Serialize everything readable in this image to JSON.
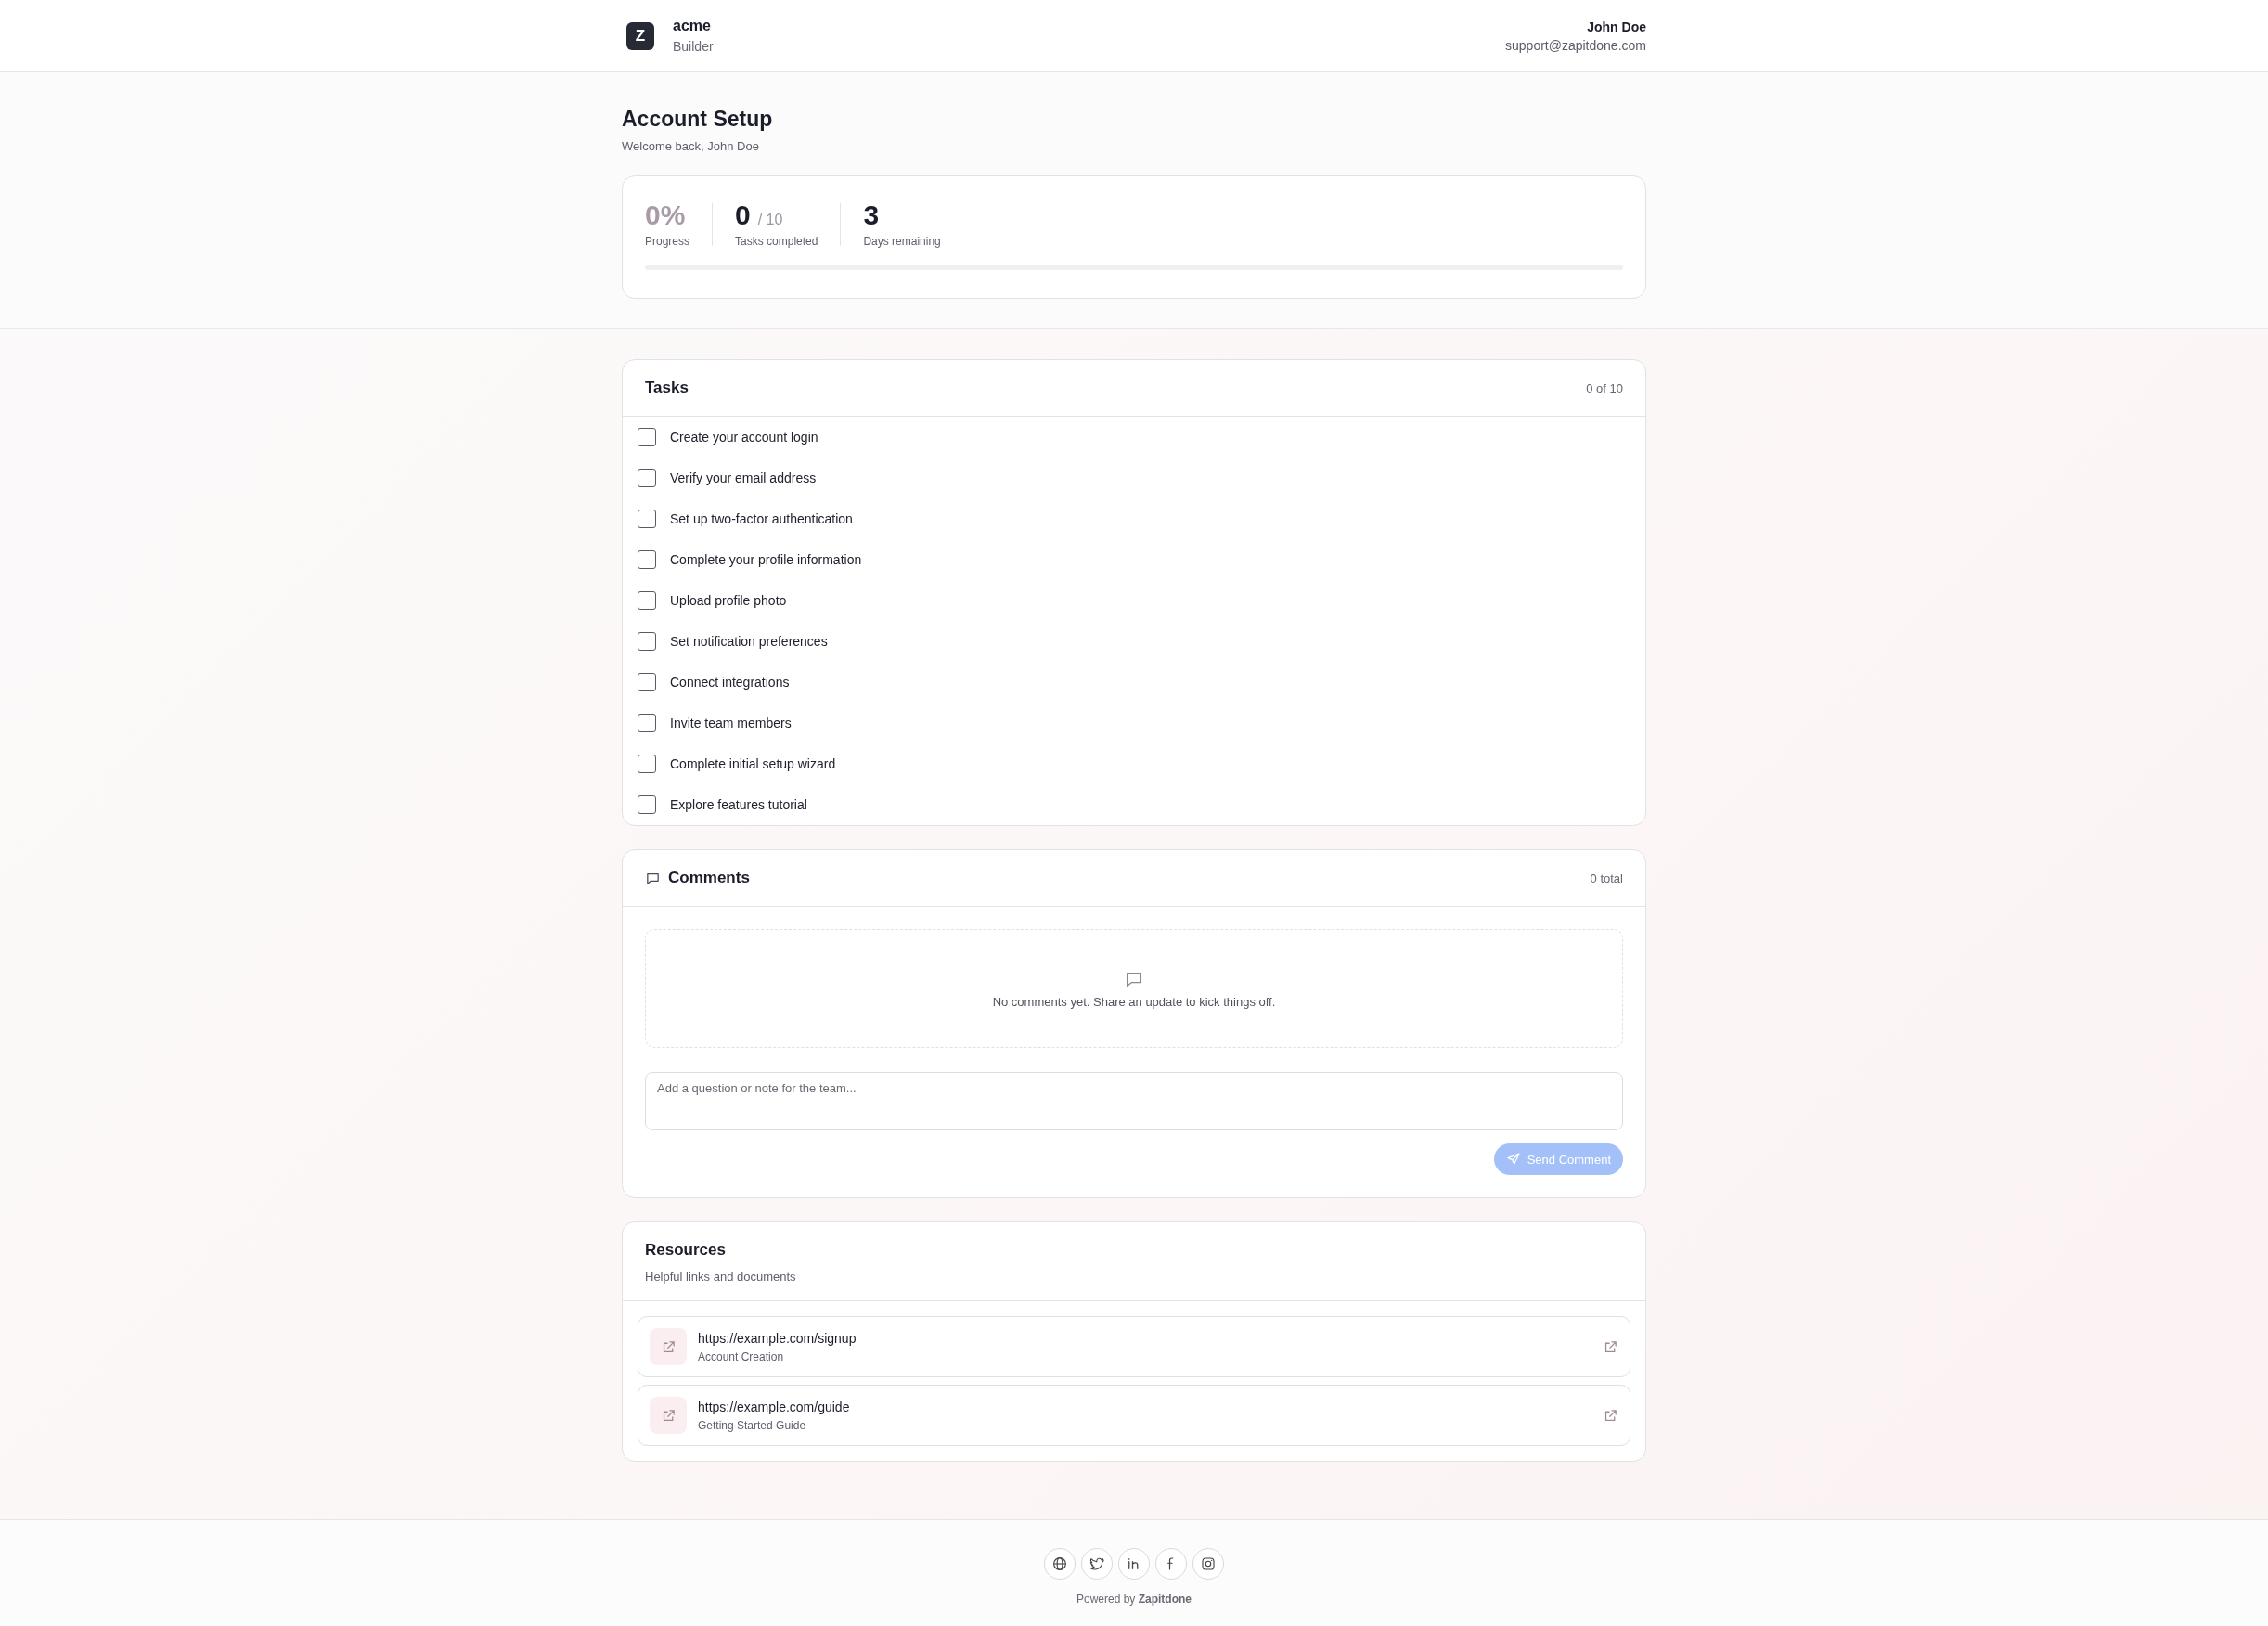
{
  "header": {
    "logo": "Z",
    "brand_name": "acme",
    "brand_subtitle": "Builder",
    "user_name": "John Doe",
    "user_email": "support@zapitdone.com"
  },
  "page": {
    "title": "Account Setup",
    "subtitle": "Welcome back, John Doe"
  },
  "stats": {
    "progress": {
      "value": "0%",
      "label": "Progress",
      "level": 0
    },
    "tasks": {
      "value": "0",
      "total": "/ 10",
      "label": "Tasks completed"
    },
    "days": {
      "value": "3",
      "label": "Days remaining"
    }
  },
  "tasks": {
    "title": "Tasks",
    "count": "0 of 10",
    "items": [
      {
        "label": "Create your account login",
        "checked": false
      },
      {
        "label": "Verify your email address",
        "checked": false
      },
      {
        "label": "Set up two-factor authentication",
        "checked": false
      },
      {
        "label": "Complete your profile information",
        "checked": false
      },
      {
        "label": "Upload profile photo",
        "checked": false
      },
      {
        "label": "Set notification preferences",
        "checked": false
      },
      {
        "label": "Connect integrations",
        "checked": false
      },
      {
        "label": "Invite team members",
        "checked": false
      },
      {
        "label": "Complete initial setup wizard",
        "checked": false
      },
      {
        "label": "Explore features tutorial",
        "checked": false
      }
    ]
  },
  "comments": {
    "title": "Comments",
    "count": "0 total",
    "empty_message": "No comments yet. Share an update to kick things off.",
    "input": {
      "placeholder": "Add a question or note for the team..."
    },
    "send_button": {
      "label": "Send Comment",
      "disabled": true
    }
  },
  "resources": {
    "title": "Resources",
    "subtitle": "Helpful links and documents",
    "items": [
      {
        "url": "https://example.com/signup",
        "name": "Account Creation"
      },
      {
        "url": "https://example.com/guide",
        "name": "Getting Started Guide"
      }
    ]
  },
  "footer": {
    "powered_by": "Powered by **Zapitdone**"
  }
}
